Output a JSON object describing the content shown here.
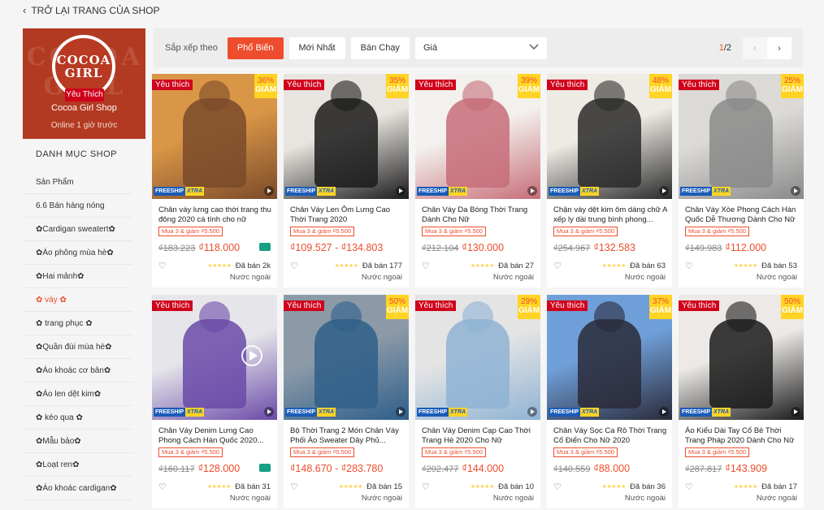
{
  "back": {
    "label": "TRỞ LẠI TRANG CỦA SHOP"
  },
  "shop": {
    "logo_line1": "COCOA",
    "logo_line2": "GIRL",
    "bg_line1": "COCOA",
    "bg_line2": "GIRL",
    "fav_tag": "Yêu Thích",
    "name": "Cocoa Girl Shop",
    "online": "Online 1 giờ trước",
    "brand_color": "#b33a22"
  },
  "categories": {
    "title": "DANH MỤC SHOP",
    "items": [
      {
        "label": "Sản Phẩm",
        "active": false
      },
      {
        "label": "6.6 Bán hàng nóng",
        "active": false
      },
      {
        "label": "✿Cardigan sweatert✿",
        "active": false
      },
      {
        "label": "✿Áo phông mùa hè✿",
        "active": false
      },
      {
        "label": "✿Hai mảnh✿",
        "active": false
      },
      {
        "label": "✿ váy ✿",
        "active": true
      },
      {
        "label": "✿ trang phục ✿",
        "active": false
      },
      {
        "label": "✿Quần đùi mùa hè✿",
        "active": false
      },
      {
        "label": "✿Áo khoác cơ bản✿",
        "active": false
      },
      {
        "label": "✿Áo len dệt kim✿",
        "active": false
      },
      {
        "label": "✿ kéo qua ✿",
        "active": false
      },
      {
        "label": "✿Mẫu bảo✿",
        "active": false
      },
      {
        "label": "✿Loạt ren✿",
        "active": false
      },
      {
        "label": "✿Áo khoác cardigan✿",
        "active": false
      }
    ]
  },
  "sort": {
    "label": "Sắp xếp theo",
    "options": [
      "Phổ Biến",
      "Mới Nhất",
      "Bán Chạy"
    ],
    "active": "Phổ Biến",
    "price_label": "Giá",
    "page_current": "1",
    "page_total": "/2",
    "accent": "#ee4d2d"
  },
  "products": [
    {
      "name": "Chân váy lưng cao thời trang thu đông 2020 cá tính cho nữ",
      "fav": "Yêu thích",
      "discount": "36%",
      "giam": "GIẢM",
      "combo": "Mua 3 & giảm ₫5.500",
      "orig": "₫183.223",
      "price": "₫118.000",
      "sold": "Đã bán 2k",
      "origin": "Nước ngoài",
      "truck": true,
      "colors": [
        "#d99646",
        "#7a4a2a"
      ]
    },
    {
      "name": "Chân Váy Len Ôm Lưng Cao Thời Trang 2020",
      "fav": "Yêu thích",
      "discount": "35%",
      "giam": "GIẢM",
      "combo": "Mua 3 & giảm ₫5.500",
      "orig": "",
      "price": "₫109.527 - ₫134.803",
      "sold": "Đã bán 177",
      "origin": "Nước ngoài",
      "truck": false,
      "colors": [
        "#e8e4df",
        "#1b1b1b"
      ]
    },
    {
      "name": "Chân Váy Da Bóng Thời Trang Dành Cho Nữ",
      "fav": "Yêu thích",
      "discount": "39%",
      "giam": "GIẢM",
      "combo": "Mua 3 & giảm ₫5.500",
      "orig": "₫212.104",
      "price": "₫130.000",
      "sold": "Đã bán 27",
      "origin": "Nước ngoài",
      "truck": false,
      "colors": [
        "#f3f1ee",
        "#c76d78"
      ]
    },
    {
      "name": "Chận váy dệt kim ôm dáng chữ A xếp ly dài trung bình phong...",
      "fav": "Yêu thích",
      "discount": "48%",
      "giam": "GIẢM",
      "combo": "Mua 3 & giảm ₫5.500",
      "orig": "₫254.967",
      "price": "₫132.583",
      "sold": "Đã bán 63",
      "origin": "Nước ngoài",
      "truck": false,
      "colors": [
        "#eeeae4",
        "#2a2a2a"
      ]
    },
    {
      "name": "Chân Váy Xòe Phong Cách Hàn Quốc Dễ Thương Dành Cho Nữ",
      "fav": "Yêu thích",
      "discount": "25%",
      "giam": "GIẢM",
      "combo": "Mua 3 & giảm ₫5.500",
      "orig": "₫149.983",
      "price": "₫112.000",
      "sold": "Đã bán 53",
      "origin": "Nước ngoài",
      "truck": false,
      "colors": [
        "#dcdad6",
        "#8a8a8a"
      ]
    },
    {
      "name": "Chân Váy Denim Lưng Cao Phong Cách Hàn Quốc 2020...",
      "fav": "Yêu thích",
      "discount": "",
      "giam": "",
      "combo": "Mua 3 & giảm ₫5.500",
      "orig": "₫160.117",
      "price": "₫128.000",
      "sold": "Đã bán 31",
      "origin": "Nước ngoài",
      "truck": true,
      "colors": [
        "#e6e6ea",
        "#6a4aa8"
      ]
    },
    {
      "name": "Bộ Thời Trang 2 Món Chân Váy Phối Áo Sweater Dây Phủ...",
      "fav": "Yêu thích",
      "discount": "50%",
      "giam": "GIẢM",
      "combo": "Mua 3 & giảm ₫5.500",
      "orig": "",
      "price": "₫148.670 - ₫283.780",
      "sold": "Đã bán 15",
      "origin": "Nước ngoài",
      "truck": false,
      "colors": [
        "#8c9aa8",
        "#2f5f8a"
      ]
    },
    {
      "name": "Chân Váy Denim Cạp Cao Thời Trang Hè 2020 Cho Nữ",
      "fav": "Yêu thích",
      "discount": "29%",
      "giam": "GIẢM",
      "combo": "Mua 3 & giảm ₫5.500",
      "orig": "₫202.477",
      "price": "₫144.000",
      "sold": "Đã bán 10",
      "origin": "Nước ngoài",
      "truck": false,
      "colors": [
        "#e4e4e4",
        "#8fb3d3"
      ]
    },
    {
      "name": "Chân Váy Sọc Ca Rô Thời Trang Cổ Điển Cho Nữ 2020",
      "fav": "Yêu thích",
      "discount": "37%",
      "giam": "GIẢM",
      "combo": "Mua 3 & giảm ₫5.500",
      "orig": "₫140.559",
      "price": "₫88.000",
      "sold": "Đã bán 36",
      "origin": "Nước ngoài",
      "truck": false,
      "colors": [
        "#6f9fd8",
        "#2a2a3a"
      ]
    },
    {
      "name": "Áo Kiểu Dài Tay Cổ Bẻ Thời Trang Pháp 2020 Dành Cho Nữ",
      "fav": "Yêu thích",
      "discount": "50%",
      "giam": "GIẢM",
      "combo": "Mua 3 & giảm ₫5.500",
      "orig": "₫287.817",
      "price": "₫143.909",
      "sold": "Đã bán 17",
      "origin": "Nước ngoài",
      "truck": false,
      "colors": [
        "#ece9e6",
        "#1b1b1b"
      ]
    }
  ],
  "badges": {
    "freeship": "FREESHIP",
    "xtra": "XTRA"
  }
}
